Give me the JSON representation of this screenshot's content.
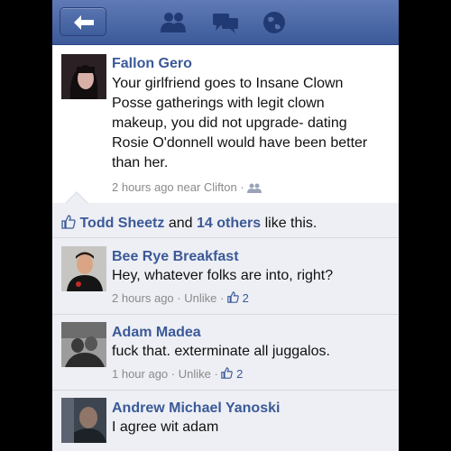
{
  "post": {
    "author": "Fallon Gero",
    "lines": [
      "Your girlfriend goes to Insane Clown",
      "Posse gatherings with legit clown",
      "makeup, you did not upgrade- dating",
      "Rosie O'donnell would have been better",
      "than her."
    ],
    "time": "2 hours ago near Clifton"
  },
  "likes": {
    "name": "Todd Sheetz",
    "and": "and",
    "others": "14 others",
    "suffix": "like this."
  },
  "comments": [
    {
      "author": "Bee Rye Breakfast",
      "text": "Hey, whatever folks are into, right?",
      "time": "2 hours ago",
      "unlike": "Unlike",
      "likes": "2"
    },
    {
      "author": "Adam Madea",
      "text": "fuck that. exterminate all juggalos.",
      "time": "1 hour ago",
      "unlike": "Unlike",
      "likes": "2"
    },
    {
      "author": "Andrew Michael Yanoski",
      "text": "I agree wit adam"
    }
  ],
  "colors": {
    "brand": "#3b5998",
    "topbar": "#4c67a8",
    "comment_bg": "#edeff4"
  },
  "icons": [
    "back-arrow-icon",
    "friends-icon",
    "messages-icon",
    "globe-icon",
    "friends-small-icon",
    "thumbs-up-icon"
  ]
}
